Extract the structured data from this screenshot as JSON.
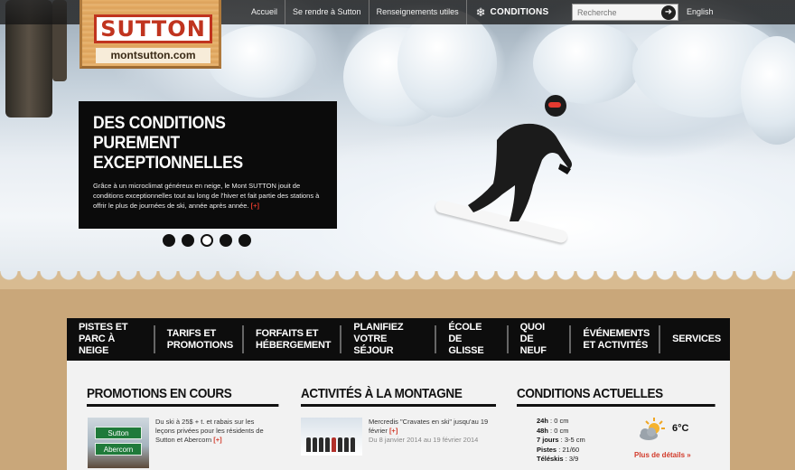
{
  "brand": {
    "name": "SUTTON",
    "url": "montsutton.com",
    "color": "#c0341f"
  },
  "topnav": {
    "links": [
      "Accueil",
      "Se rendre à Sutton",
      "Renseignements utiles"
    ],
    "conditions_label": "CONDITIONS",
    "conditions_icon": "snowflake-icon",
    "search_placeholder": "Recherche",
    "language": "English"
  },
  "promo": {
    "title_line1": "DES CONDITIONS",
    "title_line2": "PUREMENT EXCEPTIONNELLES",
    "body": "Grâce à un microclimat généreux en neige, le Mont SUTTON jouit de conditions exceptionnelles tout au long de l'hiver et fait partie des stations à offrir le plus de journées de ski, année après année.",
    "more": "[+]"
  },
  "slider": {
    "count": 5,
    "active_index": 2
  },
  "mainnav": [
    {
      "line1": "PISTES ET",
      "line2": "PARC À NEIGE"
    },
    {
      "line1": "TARIFS ET",
      "line2": "PROMOTIONS"
    },
    {
      "line1": "FORFAITS ET",
      "line2": "HÉBERGEMENT"
    },
    {
      "line1": "PLANIFIEZ",
      "line2": "VOTRE SÉJOUR"
    },
    {
      "line1": "ÉCOLE",
      "line2": "DE GLISSE"
    },
    {
      "line1": "QUOI",
      "line2": "DE NEUF"
    },
    {
      "line1": "ÉVÉNEMENTS",
      "line2": "ET ACTIVITÉS"
    },
    {
      "line1": "SERVICES",
      "line2": ""
    }
  ],
  "columns": {
    "promotions": {
      "title": "PROMOTIONS EN COURS",
      "sign_top": "Sutton",
      "sign_bottom": "Abercorn",
      "text": "Du ski à 25$ + t. et rabais sur les leçons privées pour les résidents de Sutton et Abercorn",
      "more": "[+]"
    },
    "activities": {
      "title": "ACTIVITÉS À LA MONTAGNE",
      "text": "Mercredis \"Cravates en ski\" jusqu'au 19 février",
      "date": "Du 8 janvier 2014 au 19 février 2014",
      "more": "[+]"
    },
    "conditions": {
      "title": "CONDITIONS ACTUELLES",
      "rows": [
        {
          "label": "24h",
          "value": "0 cm"
        },
        {
          "label": "48h",
          "value": "0 cm"
        },
        {
          "label": "7 jours",
          "value": "3-5 cm"
        },
        {
          "label": "Pistes",
          "value": "21/60"
        },
        {
          "label": "Téléskis",
          "value": "3/9"
        }
      ],
      "temperature": "6°C",
      "weather_icon": "partly-cloudy-icon",
      "details_link": "Plus de détails »"
    }
  }
}
